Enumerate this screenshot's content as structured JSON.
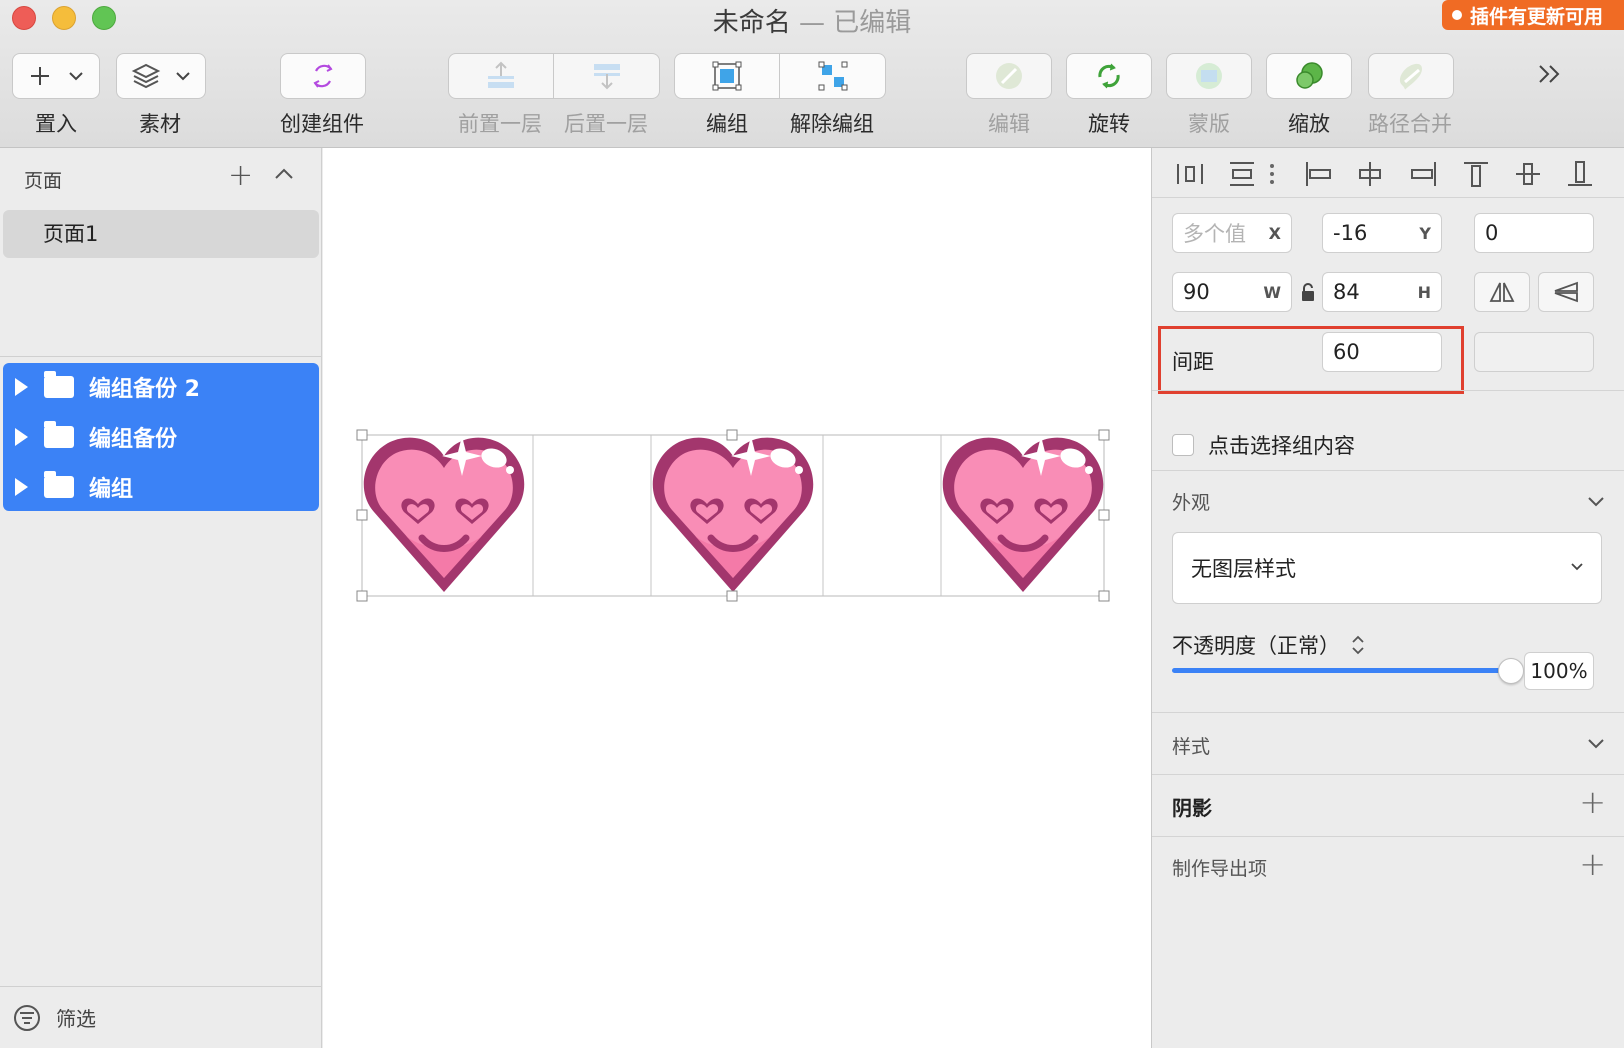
{
  "window": {
    "title": "未命名",
    "title_separator": "—",
    "status": "已编辑",
    "plugin_badge": "插件有更新可用"
  },
  "toolbar": {
    "insert": "置入",
    "assets": "素材",
    "create_symbol": "创建组件",
    "bring_forward": "前置一层",
    "send_backward": "后置一层",
    "group": "编组",
    "ungroup": "解除编组",
    "edit": "编辑",
    "rotate": "旋转",
    "mask": "蒙版",
    "scale": "缩放",
    "boolean": "路径合并"
  },
  "sidebar": {
    "pages_header": "页面",
    "pages": [
      "页面1"
    ],
    "layers": [
      "编组备份 2",
      "编组备份",
      "编组"
    ],
    "filter": "筛选"
  },
  "inspector": {
    "x_value": "多个值",
    "x_suffix": "X",
    "y_value": "-16",
    "y_suffix": "Y",
    "rotation_value": "0",
    "w_value": "90",
    "w_suffix": "W",
    "h_value": "84",
    "h_suffix": "H",
    "spacing_label": "间距",
    "spacing_value": "60",
    "click_select_label": "点击选择组内容",
    "appearance_title": "外观",
    "layer_style": "无图层样式",
    "opacity_label": "不透明度（正常）",
    "opacity_value": "100%",
    "opacity_level": 1.0,
    "style_title": "样式",
    "shadow_title": "阴影",
    "export_title": "制作导出项"
  },
  "colors": {
    "selection_blue": "#3b82f6",
    "highlight_red": "#e0402f",
    "badge_orange": "#f06b24",
    "heart_pink": "#f98db6",
    "heart_outline": "#a3366d"
  }
}
